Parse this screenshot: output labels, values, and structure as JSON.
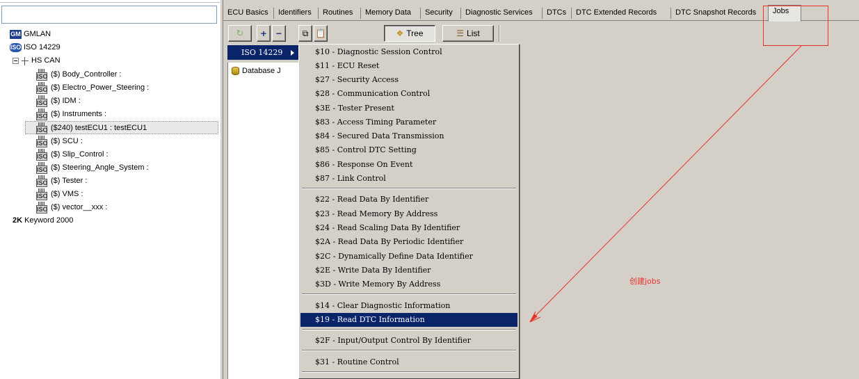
{
  "left_tree": {
    "search_value": "",
    "nodes": [
      {
        "badge": "GM",
        "label": "GMLAN"
      },
      {
        "badge": "ISO",
        "label": "ISO 14229"
      },
      {
        "label": "HS CAN"
      },
      {
        "label": "($) Body_Controller :"
      },
      {
        "label": "($) Electro_Power_Steering :"
      },
      {
        "label": "($) IDM :"
      },
      {
        "label": "($) Instruments :"
      },
      {
        "label": "($240) testECU1 : testECU1"
      },
      {
        "label": "($) SCU :"
      },
      {
        "label": "($) Slip_Control :"
      },
      {
        "label": "($) Steering_Angle_System :"
      },
      {
        "label": "($) Tester :"
      },
      {
        "label": "($) VMS :"
      },
      {
        "label": "($) vector__xxx :"
      },
      {
        "badge": "2K",
        "label": "Keyword 2000"
      }
    ],
    "ecu_icon_text": "ISO"
  },
  "tabs": [
    {
      "label": "ECU Basics"
    },
    {
      "label": "Identifiers"
    },
    {
      "label": "Routines"
    },
    {
      "label": "Memory Data"
    },
    {
      "label": "Security"
    },
    {
      "label": "Diagnostic Services"
    },
    {
      "label": "DTCs"
    },
    {
      "label": "DTC Extended Records"
    },
    {
      "label": "DTC Snapshot Records"
    },
    {
      "label": "Jobs",
      "active": true
    }
  ],
  "toolbar": {
    "tree_label": "Tree",
    "list_label": "List"
  },
  "content": {
    "db_label": "Database J"
  },
  "iso_item": {
    "label": "ISO 14229"
  },
  "menu": {
    "groups": [
      [
        "$10 - Diagnostic Session Control",
        "$11 - ECU Reset",
        "$27 - Security Access",
        "$28 - Communication Control",
        "$3E - Tester Present",
        "$83 - Access Timing Parameter",
        "$84 - Secured Data Transmission",
        "$85 - Control DTC Setting",
        "$86 - Response On Event",
        "$87 - Link Control"
      ],
      [
        "$22 - Read Data By Identifier",
        "$23 - Read Memory By Address",
        "$24 - Read Scaling Data By Identifier",
        "$2A - Read Data By Periodic Identifier",
        "$2C - Dynamically Define Data Identifier",
        "$2E - Write Data By Identifier",
        "$3D - Write Memory By Address"
      ],
      [
        "$14 - Clear Diagnostic Information",
        "$19 - Read DTC Information"
      ],
      [
        "$2F - Input/Output Control By Identifier"
      ],
      [
        "$31 - Routine Control"
      ]
    ],
    "selected": "$19 - Read DTC Information"
  },
  "annotation": {
    "text": "创建jobs",
    "color": "#e8322a"
  },
  "colors": {
    "menu_highlight": "#0a246a",
    "chrome": "#d4d0c8"
  }
}
